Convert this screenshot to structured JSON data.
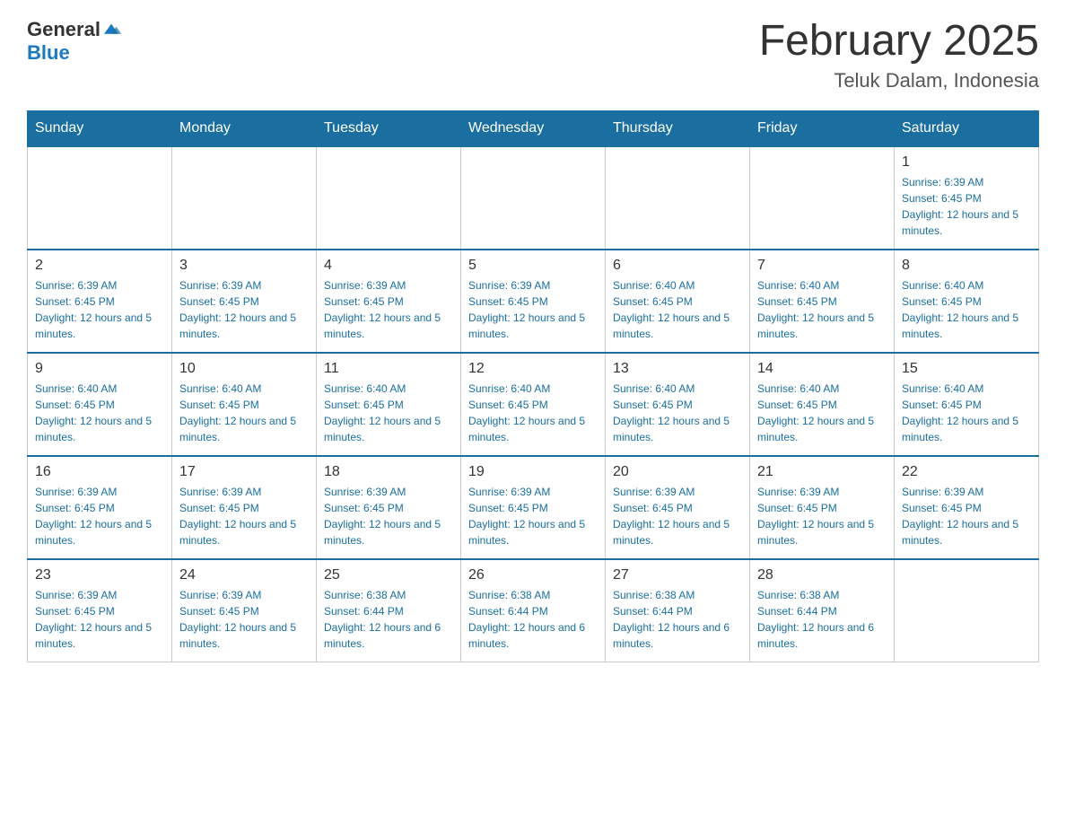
{
  "header": {
    "logo_general": "General",
    "logo_blue": "Blue",
    "title": "February 2025",
    "location": "Teluk Dalam, Indonesia"
  },
  "days_of_week": [
    "Sunday",
    "Monday",
    "Tuesday",
    "Wednesday",
    "Thursday",
    "Friday",
    "Saturday"
  ],
  "weeks": [
    [
      {
        "day": "",
        "info": ""
      },
      {
        "day": "",
        "info": ""
      },
      {
        "day": "",
        "info": ""
      },
      {
        "day": "",
        "info": ""
      },
      {
        "day": "",
        "info": ""
      },
      {
        "day": "",
        "info": ""
      },
      {
        "day": "1",
        "info": "Sunrise: 6:39 AM\nSunset: 6:45 PM\nDaylight: 12 hours and 5 minutes."
      }
    ],
    [
      {
        "day": "2",
        "info": "Sunrise: 6:39 AM\nSunset: 6:45 PM\nDaylight: 12 hours and 5 minutes."
      },
      {
        "day": "3",
        "info": "Sunrise: 6:39 AM\nSunset: 6:45 PM\nDaylight: 12 hours and 5 minutes."
      },
      {
        "day": "4",
        "info": "Sunrise: 6:39 AM\nSunset: 6:45 PM\nDaylight: 12 hours and 5 minutes."
      },
      {
        "day": "5",
        "info": "Sunrise: 6:39 AM\nSunset: 6:45 PM\nDaylight: 12 hours and 5 minutes."
      },
      {
        "day": "6",
        "info": "Sunrise: 6:40 AM\nSunset: 6:45 PM\nDaylight: 12 hours and 5 minutes."
      },
      {
        "day": "7",
        "info": "Sunrise: 6:40 AM\nSunset: 6:45 PM\nDaylight: 12 hours and 5 minutes."
      },
      {
        "day": "8",
        "info": "Sunrise: 6:40 AM\nSunset: 6:45 PM\nDaylight: 12 hours and 5 minutes."
      }
    ],
    [
      {
        "day": "9",
        "info": "Sunrise: 6:40 AM\nSunset: 6:45 PM\nDaylight: 12 hours and 5 minutes."
      },
      {
        "day": "10",
        "info": "Sunrise: 6:40 AM\nSunset: 6:45 PM\nDaylight: 12 hours and 5 minutes."
      },
      {
        "day": "11",
        "info": "Sunrise: 6:40 AM\nSunset: 6:45 PM\nDaylight: 12 hours and 5 minutes."
      },
      {
        "day": "12",
        "info": "Sunrise: 6:40 AM\nSunset: 6:45 PM\nDaylight: 12 hours and 5 minutes."
      },
      {
        "day": "13",
        "info": "Sunrise: 6:40 AM\nSunset: 6:45 PM\nDaylight: 12 hours and 5 minutes."
      },
      {
        "day": "14",
        "info": "Sunrise: 6:40 AM\nSunset: 6:45 PM\nDaylight: 12 hours and 5 minutes."
      },
      {
        "day": "15",
        "info": "Sunrise: 6:40 AM\nSunset: 6:45 PM\nDaylight: 12 hours and 5 minutes."
      }
    ],
    [
      {
        "day": "16",
        "info": "Sunrise: 6:39 AM\nSunset: 6:45 PM\nDaylight: 12 hours and 5 minutes."
      },
      {
        "day": "17",
        "info": "Sunrise: 6:39 AM\nSunset: 6:45 PM\nDaylight: 12 hours and 5 minutes."
      },
      {
        "day": "18",
        "info": "Sunrise: 6:39 AM\nSunset: 6:45 PM\nDaylight: 12 hours and 5 minutes."
      },
      {
        "day": "19",
        "info": "Sunrise: 6:39 AM\nSunset: 6:45 PM\nDaylight: 12 hours and 5 minutes."
      },
      {
        "day": "20",
        "info": "Sunrise: 6:39 AM\nSunset: 6:45 PM\nDaylight: 12 hours and 5 minutes."
      },
      {
        "day": "21",
        "info": "Sunrise: 6:39 AM\nSunset: 6:45 PM\nDaylight: 12 hours and 5 minutes."
      },
      {
        "day": "22",
        "info": "Sunrise: 6:39 AM\nSunset: 6:45 PM\nDaylight: 12 hours and 5 minutes."
      }
    ],
    [
      {
        "day": "23",
        "info": "Sunrise: 6:39 AM\nSunset: 6:45 PM\nDaylight: 12 hours and 5 minutes."
      },
      {
        "day": "24",
        "info": "Sunrise: 6:39 AM\nSunset: 6:45 PM\nDaylight: 12 hours and 5 minutes."
      },
      {
        "day": "25",
        "info": "Sunrise: 6:38 AM\nSunset: 6:44 PM\nDaylight: 12 hours and 6 minutes."
      },
      {
        "day": "26",
        "info": "Sunrise: 6:38 AM\nSunset: 6:44 PM\nDaylight: 12 hours and 6 minutes."
      },
      {
        "day": "27",
        "info": "Sunrise: 6:38 AM\nSunset: 6:44 PM\nDaylight: 12 hours and 6 minutes."
      },
      {
        "day": "28",
        "info": "Sunrise: 6:38 AM\nSunset: 6:44 PM\nDaylight: 12 hours and 6 minutes."
      },
      {
        "day": "",
        "info": ""
      }
    ]
  ]
}
